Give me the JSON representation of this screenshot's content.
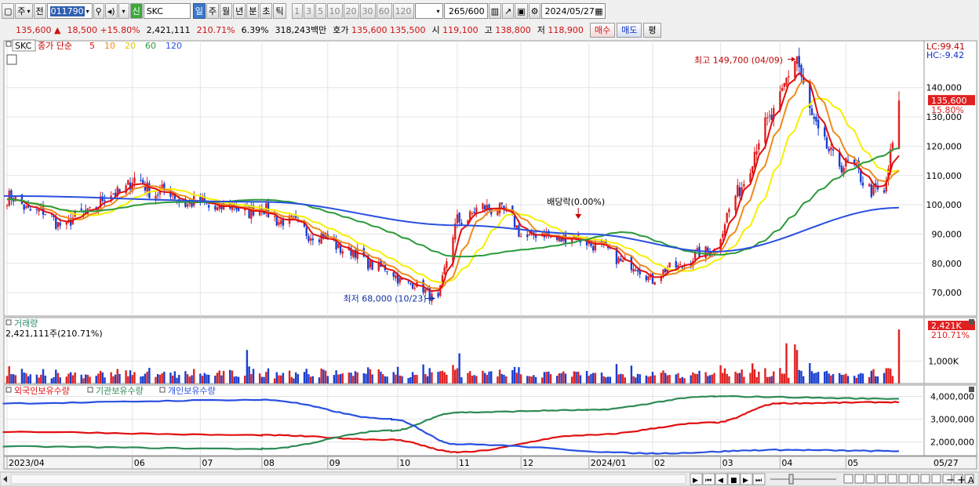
{
  "toolbar": {
    "period_sel": "주",
    "prev_label": "전",
    "code": "011790",
    "credit_badge": "신",
    "stock_name": "SKC",
    "periods": [
      "일",
      "주",
      "월",
      "년",
      "분",
      "초",
      "틱"
    ],
    "intervals": [
      "1",
      "3",
      "5",
      "10",
      "20",
      "30",
      "60",
      "120"
    ],
    "count": "265",
    "count_total": "/600",
    "date": "2024/05/27"
  },
  "quote": {
    "price": "135,600",
    "arrow": "▲",
    "change": "18,500",
    "change_pct": "+15.80%",
    "volume": "2,421,111",
    "volume_ratio": "210.71%",
    "turnover": "6.39%",
    "amount": "318,243백만",
    "ask_label": "호가",
    "ask": "135,600",
    "bid": "135,500",
    "open_label": "시",
    "open": "119,100",
    "high_label": "고",
    "high": "138,800",
    "low_label": "저",
    "low": "118,900",
    "buy_label": "매수",
    "sell_label": "매도",
    "eval_label": "평"
  },
  "colors": {
    "up": "#e02020",
    "down": "#1a3fd0",
    "ma5": "#e01010",
    "ma10": "#f08a1a",
    "ma20": "#f5f000",
    "ma60": "#2a9a3a",
    "ma120": "#2a50e0",
    "foreign": "#e01010",
    "inst": "#2e8b57",
    "indiv": "#2a50e0"
  },
  "chart_data": [
    {
      "type": "candlestick",
      "legend": {
        "symbol": "SKC",
        "label": "종가 단순",
        "ma": [
          "5",
          "10",
          "20",
          "60",
          "120"
        ]
      },
      "ylim": [
        62000,
        156000
      ],
      "yticks": [
        70000,
        80000,
        90000,
        100000,
        110000,
        120000,
        130000,
        140000
      ],
      "ytick_labels": [
        "70,000",
        "80,000",
        "90,000",
        "100,000",
        "110,000",
        "120,000",
        "130,000",
        "140,000"
      ],
      "right_labels": {
        "lc": "LC:99.41",
        "hc": "HC:-9.42",
        "price": "135,600",
        "pct": "15.80%"
      },
      "annotations": {
        "high": "최고 149,700 (04/09)",
        "low": "최저 68,000 (10/23)",
        "dividend": "배당락(0.00%)"
      },
      "key_points": [
        {
          "date": "2023/04",
          "close": 103000
        },
        {
          "date": "2023/05",
          "close": 93000
        },
        {
          "date": "2023/06",
          "close": 108000
        },
        {
          "date": "2023/07",
          "close": 100000
        },
        {
          "date": "2023/08",
          "close": 98000
        },
        {
          "date": "2023/09",
          "close": 88000
        },
        {
          "date": "2023/10/23",
          "low": 68000
        },
        {
          "date": "2023/11",
          "close": 95000
        },
        {
          "date": "2023/11/20",
          "close": 100000
        },
        {
          "date": "2023/12",
          "close": 90000
        },
        {
          "date": "2024/01",
          "close": 88000
        },
        {
          "date": "2024/02",
          "close": 75000
        },
        {
          "date": "2024/03",
          "close": 85000
        },
        {
          "date": "2024/03/20",
          "close": 118000
        },
        {
          "date": "2024/04/09",
          "high": 149700
        },
        {
          "date": "2024/04/20",
          "close": 120000
        },
        {
          "date": "2024/05/05",
          "close": 112000
        },
        {
          "date": "2024/05/20",
          "close": 102000
        },
        {
          "date": "2024/05/27",
          "open": 119100,
          "high": 138800,
          "low": 118900,
          "close": 135600
        }
      ],
      "ma120_points": [
        {
          "date": "2023/04",
          "value": 103000
        },
        {
          "date": "2023/08",
          "value": 101000
        },
        {
          "date": "2023/11",
          "value": 93000
        },
        {
          "date": "2024/01",
          "value": 90000
        },
        {
          "date": "2024/03",
          "value": 84000
        },
        {
          "date": "2024/05/27",
          "value": 99000
        }
      ]
    },
    {
      "type": "bar",
      "title": "거래량",
      "value_label": "2,421,111주(210.71%)",
      "ylim": [
        0,
        2600000
      ],
      "ytick_labels": [
        "1,000K"
      ],
      "right_labels": {
        "last": "2,421K",
        "pct": "210.71%"
      },
      "last_value": 2421111
    },
    {
      "type": "line",
      "legend": [
        "외국인보유수량",
        "기관보유수량",
        "개인보유수량"
      ],
      "ylim": [
        1400000,
        4500000
      ],
      "ytick_labels": [
        "2,000,000",
        "3,000,000",
        "4,000,000"
      ],
      "series": [
        {
          "name": "외국인보유수량",
          "points": [
            {
              "date": "2023/04",
              "value": 2450000
            },
            {
              "date": "2023/08",
              "value": 2300000
            },
            {
              "date": "2023/10",
              "value": 2100000
            },
            {
              "date": "2023/11",
              "value": 1550000
            },
            {
              "date": "2024/01",
              "value": 2300000
            },
            {
              "date": "2024/03",
              "value": 2850000
            },
            {
              "date": "2024/04",
              "value": 3700000
            },
            {
              "date": "2024/05/27",
              "value": 3750000
            }
          ]
        },
        {
          "name": "기관보유수량",
          "points": [
            {
              "date": "2023/04",
              "value": 1800000
            },
            {
              "date": "2023/08",
              "value": 1700000
            },
            {
              "date": "2023/10",
              "value": 2500000
            },
            {
              "date": "2023/11",
              "value": 3300000
            },
            {
              "date": "2024/01",
              "value": 3400000
            },
            {
              "date": "2024/03",
              "value": 4000000
            },
            {
              "date": "2024/05/27",
              "value": 3900000
            }
          ]
        },
        {
          "name": "개인보유수량",
          "points": [
            {
              "date": "2023/04",
              "value": 3700000
            },
            {
              "date": "2023/08",
              "value": 3850000
            },
            {
              "date": "2023/10",
              "value": 3000000
            },
            {
              "date": "2023/11",
              "value": 1900000
            },
            {
              "date": "2024/02",
              "value": 1500000
            },
            {
              "date": "2024/04",
              "value": 1650000
            },
            {
              "date": "2024/05/27",
              "value": 1600000
            }
          ]
        }
      ]
    }
  ],
  "xaxis": {
    "labels": [
      "2023/04",
      "06",
      "07",
      "08",
      "09",
      "10",
      "11",
      "12",
      "2024/01",
      "02",
      "03",
      "04",
      "05"
    ],
    "right_label": "05/27"
  }
}
